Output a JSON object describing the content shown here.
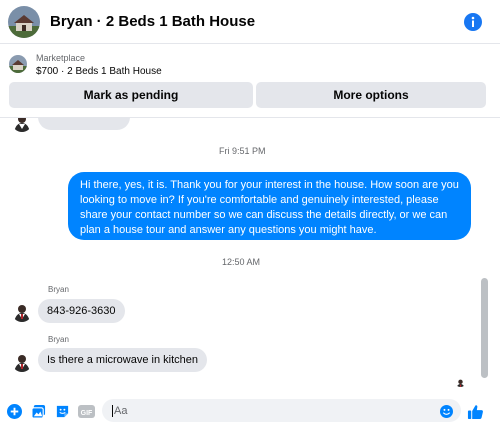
{
  "header": {
    "title": "Bryan · 2 Beds 1 Bath House"
  },
  "marketplace": {
    "label": "Marketplace",
    "item": "$700 · 2 Beds 1 Bath House",
    "mark_pending_label": "Mark as pending",
    "more_options_label": "More options"
  },
  "messages": {
    "timestamp_1": "Fri 9:51 PM",
    "outgoing_1": "Hi there, yes, it is. Thank you for your interest in the house. How soon are you looking to move in? If you're comfortable and genuinely interested, please share your contact number so we can discuss the details directly, or we can plan a house tour and answer any questions you might have.",
    "timestamp_2": "12:50 AM",
    "sender_1": "Bryan",
    "incoming_1": "843-926-3630",
    "sender_2": "Bryan",
    "incoming_2": "Is there a microwave in kitchen"
  },
  "composer": {
    "placeholder": "Aa",
    "gif_label": "GIF"
  },
  "icons": [
    "info-icon",
    "plus-icon",
    "photo-icon",
    "sticker-icon",
    "gif-icon",
    "emoji-icon",
    "like-icon"
  ],
  "colors": {
    "accent": "#0084ff",
    "brand": "#1877f2",
    "bubble_gray": "#e4e6eb"
  }
}
